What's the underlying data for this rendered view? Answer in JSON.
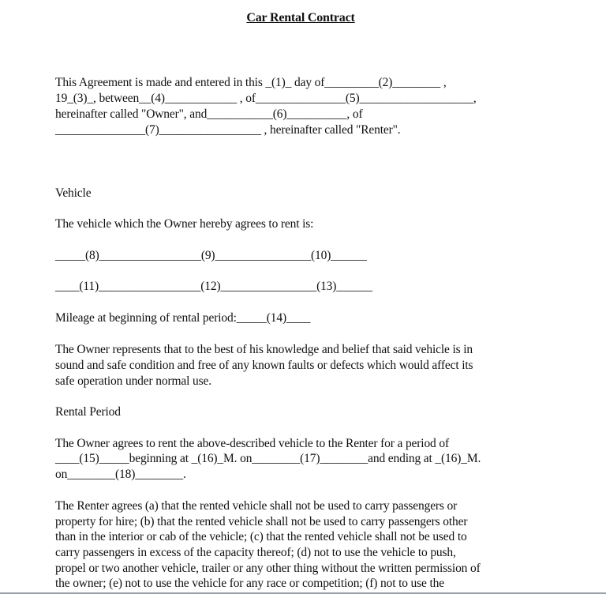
{
  "document": {
    "title": "Car Rental Contract",
    "agreement_lines": [
      "This Agreement is made and entered in this _(1)_ day of_________(2)________ ,",
      "19_(3)_, between__(4)____________ , of_______________(5)___________________,",
      "hereinafter called \"Owner\", and___________(6)__________, of",
      "_______________(7)_________________ , hereinafter called \"Renter\"."
    ],
    "vehicle_heading": "Vehicle",
    "vehicle_intro": "The vehicle which the Owner hereby agrees to rent is:",
    "vehicle_blanks_row1": "_____(8)_________________(9)________________(10)______",
    "vehicle_blanks_row2": "____(11)_________________(12)________________(13)______",
    "mileage": "Mileage at beginning of rental period:_____(14)____",
    "condition_lines": [
      "The Owner represents that to the best of his knowledge and belief that said vehicle is in",
      "sound and safe condition and free of any known faults or defects which would affect its",
      "safe operation under normal use."
    ],
    "rental_period_heading": "Rental Period",
    "rental_period_lines": [
      "The Owner agrees to rent the above-described vehicle to the Renter for a period of",
      "____(15)_____beginning at _(16)_M. on________(17)________and ending at _(16)_M.",
      "on________(18)________."
    ],
    "renter_agrees_lines": [
      "The Renter agrees (a) that the rented vehicle shall not be used to carry passengers or",
      "property for hire; (b) that the rented vehicle shall not be used to carry passengers other",
      "than in the interior or cab of the vehicle; (c) that the rented vehicle shall not be used to",
      "carry passengers in excess of the capacity thereof; (d) not to use the vehicle to push,",
      "propel or two another vehicle, trailer or any other thing without the written permission of",
      "the owner; (e) not to use the vehicle for any race or competition; (f) not to use the"
    ]
  }
}
